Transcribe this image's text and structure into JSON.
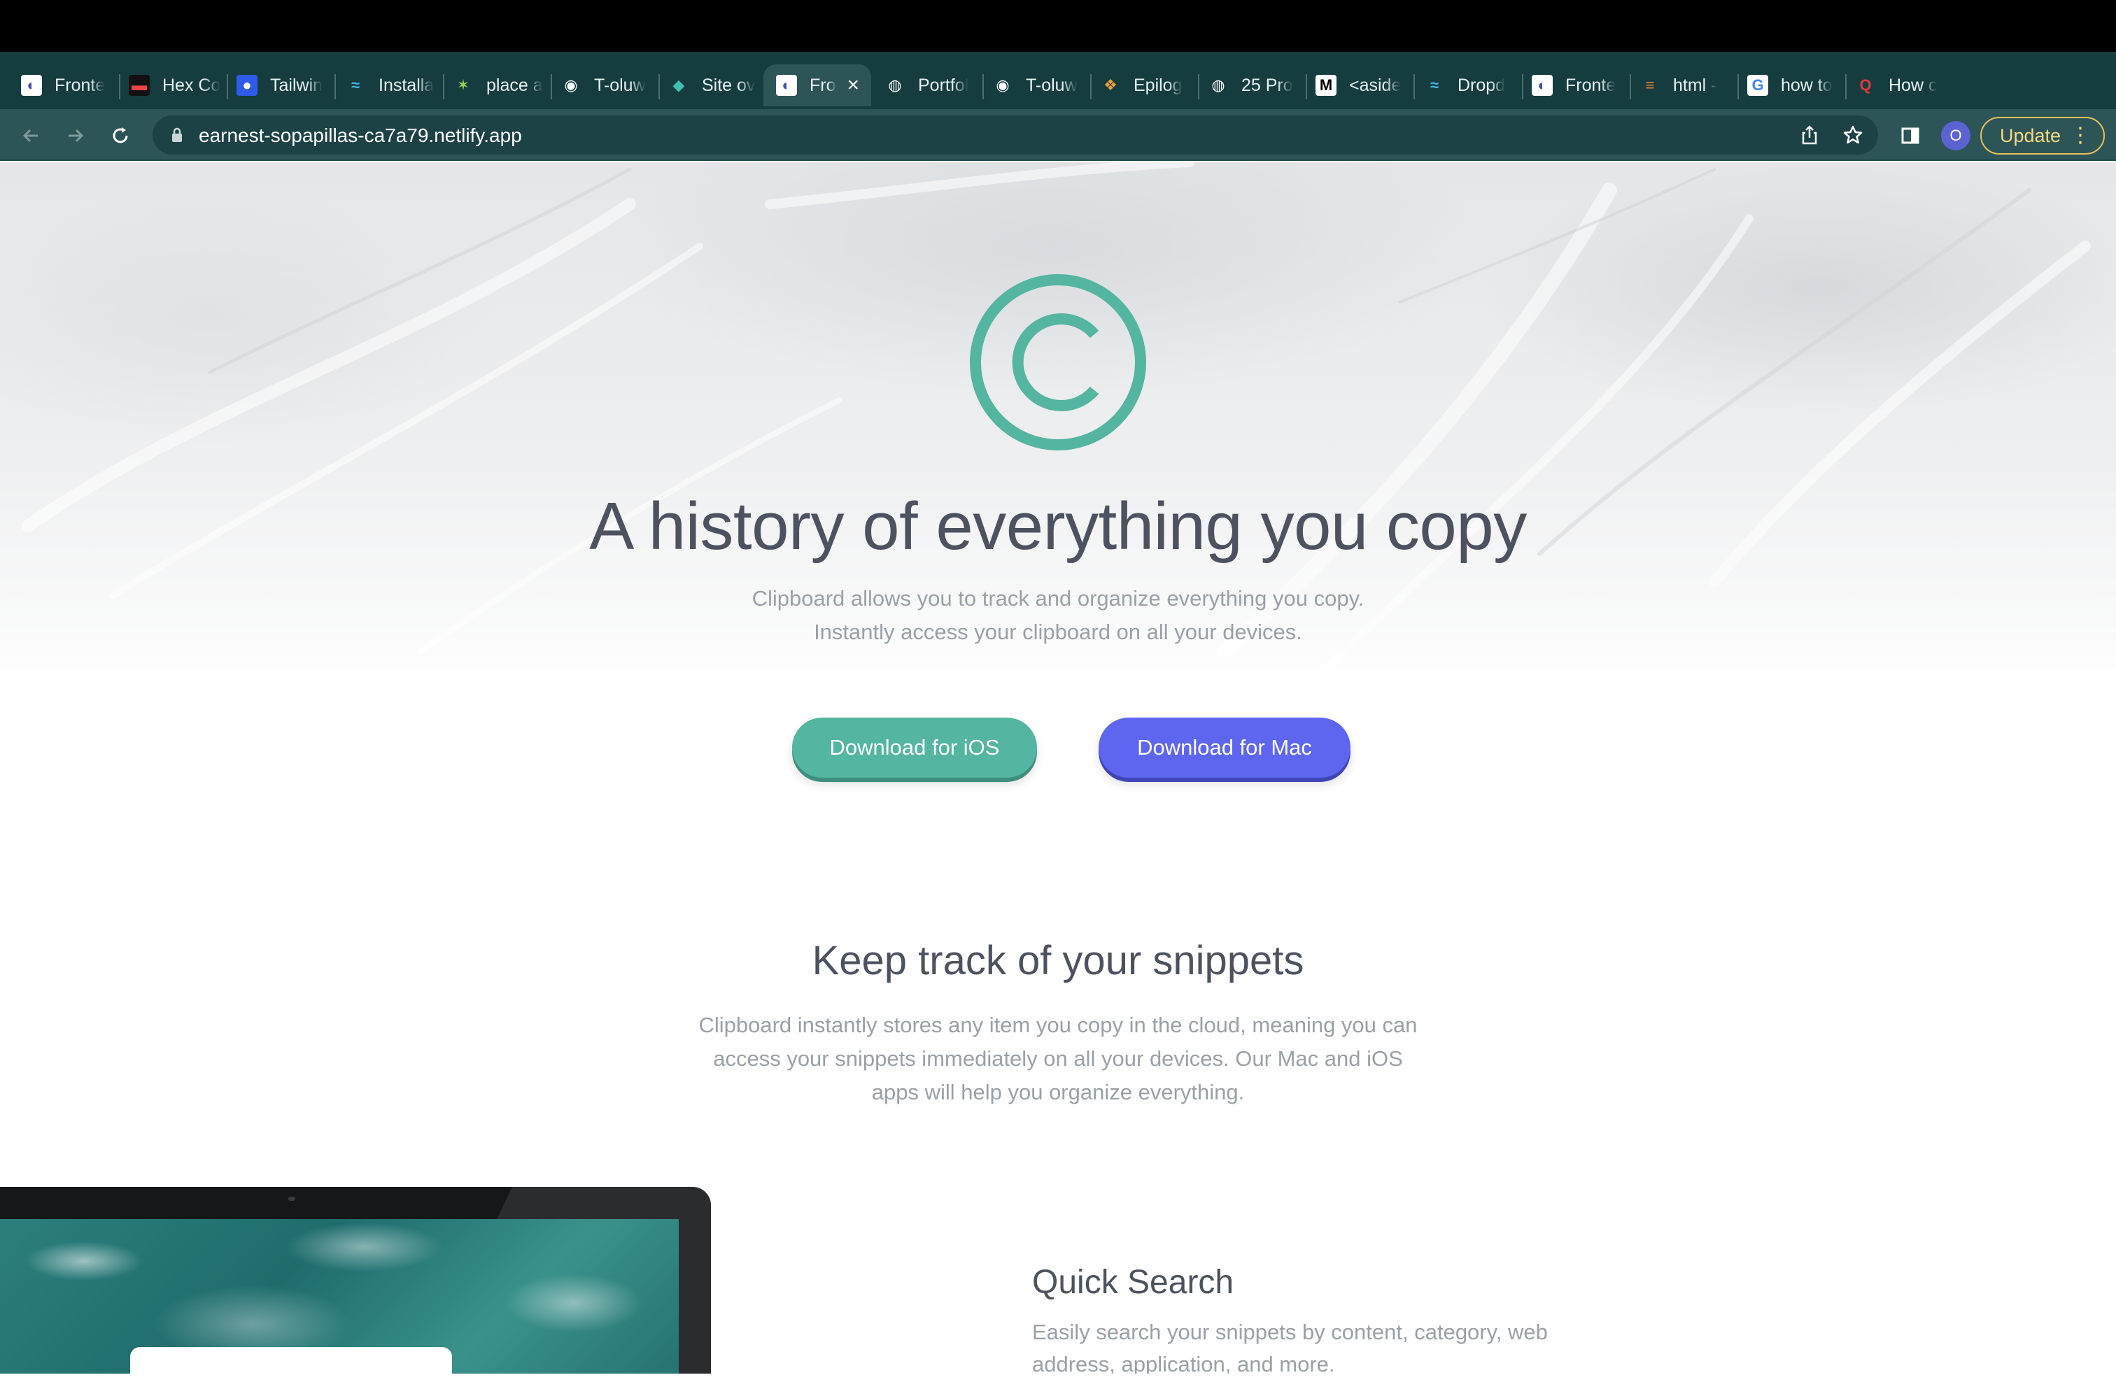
{
  "browser": {
    "tabs": [
      {
        "title": "Fronte",
        "icon": "frontend-mentor-icon"
      },
      {
        "title": "Hex Co",
        "icon": "hex-color-icon"
      },
      {
        "title": "Tailwin",
        "icon": "tailwind-circle-icon"
      },
      {
        "title": "Installa",
        "icon": "tailwind-icon"
      },
      {
        "title": "place a",
        "icon": "sparkle-icon"
      },
      {
        "title": "T-oluw",
        "icon": "github-icon"
      },
      {
        "title": "Site ov",
        "icon": "netlify-icon"
      },
      {
        "title": "Fro",
        "icon": "frontend-mentor-icon",
        "active": true
      },
      {
        "title": "Portfol",
        "icon": "globe-icon"
      },
      {
        "title": "T-oluw",
        "icon": "github-icon"
      },
      {
        "title": "Epilog",
        "icon": "epilogue-font-icon"
      },
      {
        "title": "25 Pro",
        "icon": "globe-icon"
      },
      {
        "title": "<aside",
        "icon": "mdn-icon"
      },
      {
        "title": "Dropd",
        "icon": "tailwind-icon"
      },
      {
        "title": "Fronte",
        "icon": "frontend-mentor-icon"
      },
      {
        "title": "html -",
        "icon": "stackoverflow-icon"
      },
      {
        "title": "how to",
        "icon": "google-icon"
      },
      {
        "title": "How c",
        "icon": "quora-icon"
      }
    ],
    "new_tab_label": "+",
    "url": "earnest-sopapillas-ca7a79.netlify.app",
    "avatar_initial": "O",
    "update_label": "Update",
    "colors": {
      "tab_strip": "#153c3f",
      "toolbar": "#2d5457",
      "update_border": "#e6c35c"
    }
  },
  "hero": {
    "logo_icon": "copyright-logo-icon",
    "title": "A history of everything you copy",
    "subtitle": "Clipboard allows you to track and organize everything you copy. Instantly access your clipboard on all your devices.",
    "buttons": {
      "ios": "Download for iOS",
      "mac": "Download for Mac"
    },
    "colors": {
      "accent_teal": "#54b5a0",
      "accent_indigo": "#5e66ef",
      "heading": "#4c525f",
      "body": "#9aa0a8"
    }
  },
  "snippets": {
    "title": "Keep track of your snippets",
    "text": "Clipboard instantly stores any item you copy in the cloud, meaning you can access your snippets immediately on all your devices. Our Mac and iOS apps will help you organize everything."
  },
  "feature": {
    "title": "Quick Search",
    "text": "Easily search your snippets by content, category, web address, application, and more."
  }
}
